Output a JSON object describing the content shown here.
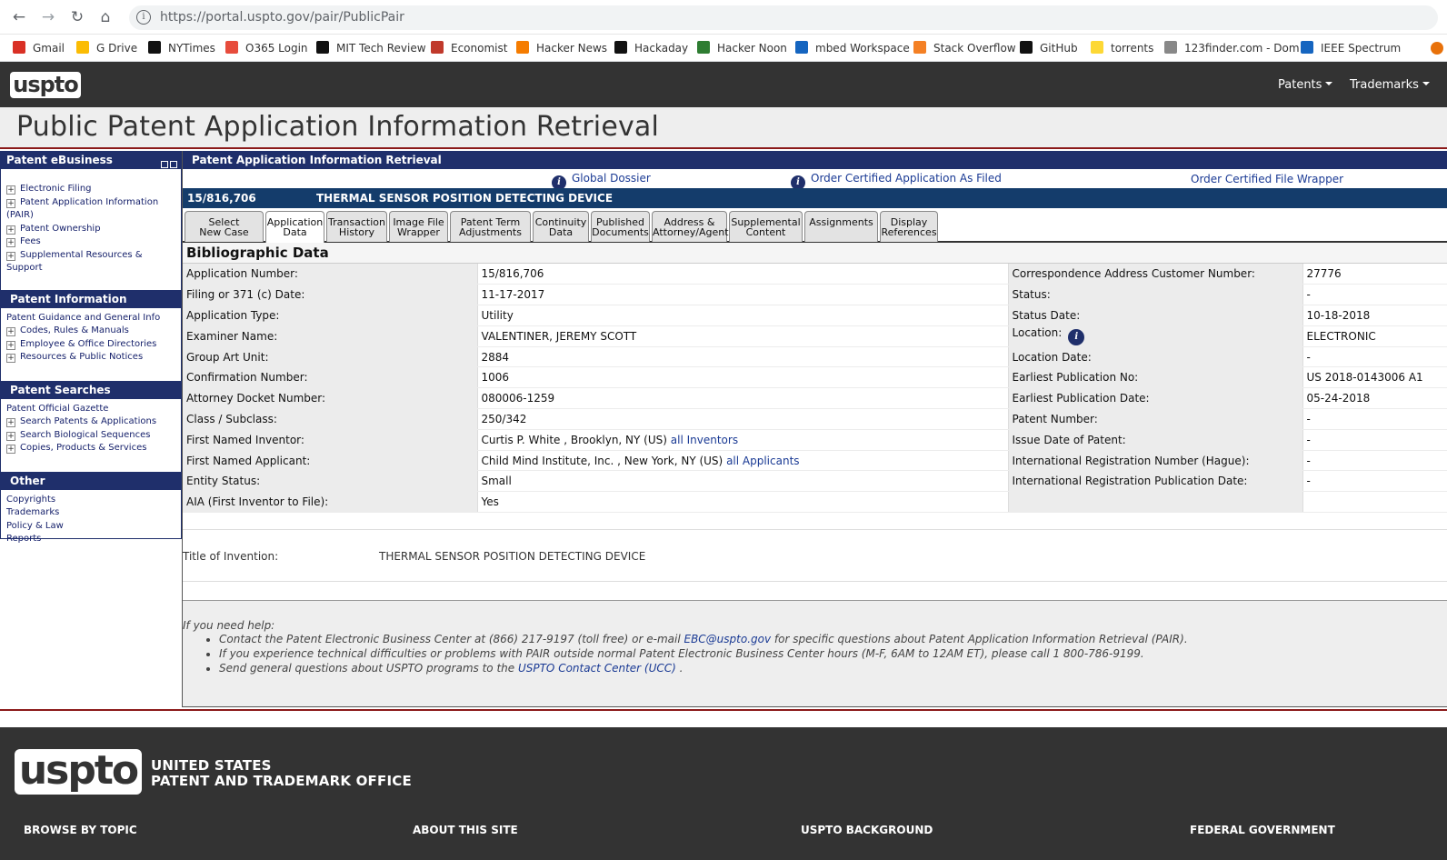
{
  "browser": {
    "url": "https://portal.uspto.gov/pair/PublicPair",
    "bookmarks": [
      "Gmail",
      "G Drive",
      "NYTimes",
      "O365 Login",
      "MIT Tech Review",
      "Economist",
      "Hacker News",
      "Hackaday",
      "Hacker Noon",
      "mbed Workspace",
      "Stack Overflow",
      "GitHub",
      "torrents",
      "123finder.com - Dom",
      "IEEE Spectrum"
    ]
  },
  "header": {
    "logo": "uspto",
    "menu": [
      "Patents",
      "Trademarks"
    ],
    "page_title": "Public Patent Application Information Retrieval"
  },
  "sidebar": {
    "sections": [
      {
        "title": "Patent eBusiness",
        "items": [
          {
            "label": "Electronic Filing",
            "expandable": true
          },
          {
            "label": "Patent Application Information (PAIR)",
            "expandable": true
          },
          {
            "label": "Patent Ownership",
            "expandable": true
          },
          {
            "label": "Fees",
            "expandable": true
          },
          {
            "label": "Supplemental Resources & Support",
            "expandable": true
          }
        ]
      },
      {
        "title": "Patent Information",
        "items": [
          {
            "label": "Patent Guidance and General Info",
            "expandable": false
          },
          {
            "label": "Codes, Rules & Manuals",
            "expandable": true
          },
          {
            "label": "Employee & Office Directories",
            "expandable": true
          },
          {
            "label": "Resources & Public Notices",
            "expandable": true
          }
        ]
      },
      {
        "title": "Patent Searches",
        "items": [
          {
            "label": "Patent Official Gazette",
            "expandable": false
          },
          {
            "label": "Search Patents & Applications",
            "expandable": true
          },
          {
            "label": "Search Biological Sequences",
            "expandable": true
          },
          {
            "label": "Copies, Products & Services",
            "expandable": true
          }
        ]
      },
      {
        "title": "Other",
        "items": [
          {
            "label": "Copyrights",
            "expandable": false
          },
          {
            "label": "Trademarks",
            "expandable": false
          },
          {
            "label": "Policy & Law",
            "expandable": false
          },
          {
            "label": "Reports",
            "expandable": false
          }
        ]
      }
    ]
  },
  "main": {
    "heading": "Patent Application Information Retrieval",
    "top_links": [
      "Global Dossier",
      "Order Certified Application As Filed",
      "Order Certified File Wrapper"
    ],
    "case_number": "15/816,706",
    "case_title": "THERMAL SENSOR POSITION DETECTING DEVICE",
    "tabs": [
      {
        "label": [
          "Select",
          "New Case"
        ],
        "active": false
      },
      {
        "label": [
          "Application",
          "Data"
        ],
        "active": true
      },
      {
        "label": [
          "Transaction",
          "History"
        ],
        "active": false
      },
      {
        "label": [
          "Image File",
          "Wrapper"
        ],
        "active": false
      },
      {
        "label": [
          "Patent Term",
          "Adjustments"
        ],
        "active": false
      },
      {
        "label": [
          "Continuity",
          "Data"
        ],
        "active": false
      },
      {
        "label": [
          "Published",
          "Documents"
        ],
        "active": false
      },
      {
        "label": [
          "Address &",
          "Attorney/Agent"
        ],
        "active": false
      },
      {
        "label": [
          "Supplemental",
          "Content"
        ],
        "active": false
      },
      {
        "label": [
          "Assignments",
          ""
        ],
        "active": false
      },
      {
        "label": [
          "Display",
          "References"
        ],
        "active": false
      }
    ],
    "bib_heading": "Bibliographic Data",
    "bib_rows": [
      {
        "l1": "Application Number:",
        "v1": "15/816,706",
        "l2": "Correspondence Address Customer Number:",
        "v2": "27776"
      },
      {
        "l1": "Filing or 371 (c) Date:",
        "v1": "11-17-2017",
        "l2": "Status:",
        "v2": "-"
      },
      {
        "l1": "Application Type:",
        "v1": "Utility",
        "l2": "Status Date:",
        "v2": "10-18-2018"
      },
      {
        "l1": "Examiner Name:",
        "v1": "VALENTINER, JEREMY SCOTT",
        "l2": "Location:",
        "v2": "ELECTRONIC",
        "l2_info": true
      },
      {
        "l1": "Group Art Unit:",
        "v1": "2884",
        "l2": "Location Date:",
        "v2": "-"
      },
      {
        "l1": "Confirmation Number:",
        "v1": "1006",
        "l2": "Earliest Publication No:",
        "v2": "US 2018-0143006 A1"
      },
      {
        "l1": "Attorney Docket Number:",
        "v1": "080006-1259",
        "l2": "Earliest Publication Date:",
        "v2": "05-24-2018"
      },
      {
        "l1": "Class / Subclass:",
        "v1": "250/342",
        "l2": "Patent Number:",
        "v2": "-"
      },
      {
        "l1": "First Named Inventor:",
        "v1": "Curtis P. White , Brooklyn, NY (US)",
        "v1_link": "all Inventors",
        "l2": "Issue Date of Patent:",
        "v2": "-"
      },
      {
        "l1": "First Named Applicant:",
        "v1": "Child Mind Institute, Inc. , New York, NY (US)",
        "v1_link": "all Applicants",
        "l2": "International Registration Number (Hague):",
        "v2": "-"
      },
      {
        "l1": "Entity Status:",
        "v1": "Small",
        "l2": "International Registration Publication Date:",
        "v2": "-"
      },
      {
        "l1": "AIA (First Inventor to File):",
        "v1": "Yes",
        "l2": "",
        "v2": ""
      }
    ],
    "title_of_invention_label": "Title of Invention:",
    "title_of_invention": "THERMAL SENSOR POSITION DETECTING DEVICE",
    "help": {
      "title": "If you need help:",
      "items": [
        {
          "pre": "Contact the Patent Electronic Business Center at (866) 217-9197 (toll free) or e-mail ",
          "link": "EBC@uspto.gov",
          "post": " for specific questions about Patent Application Information Retrieval (PAIR)."
        },
        {
          "pre": "If you experience technical difficulties or problems with PAIR outside normal Patent Electronic Business Center hours (M-F, 6AM to 12AM ET), please call 1 800-786-9199.",
          "link": "",
          "post": ""
        },
        {
          "pre": "Send general questions about USPTO programs to the ",
          "link": "USPTO Contact Center (UCC)",
          "post": " ."
        }
      ]
    }
  },
  "footer": {
    "logo": "uspto",
    "org_line1": "UNITED STATES",
    "org_line2": "PATENT AND TRADEMARK OFFICE",
    "columns": [
      "BROWSE BY TOPIC",
      "ABOUT THIS SITE",
      "USPTO BACKGROUND",
      "FEDERAL GOVERNMENT"
    ]
  },
  "colors": {
    "navy": "#1f2f6b",
    "case_bar": "#143c6b",
    "header_dark": "#333333",
    "accent_red": "#8b1a1a",
    "link_blue": "#1a3a94"
  }
}
